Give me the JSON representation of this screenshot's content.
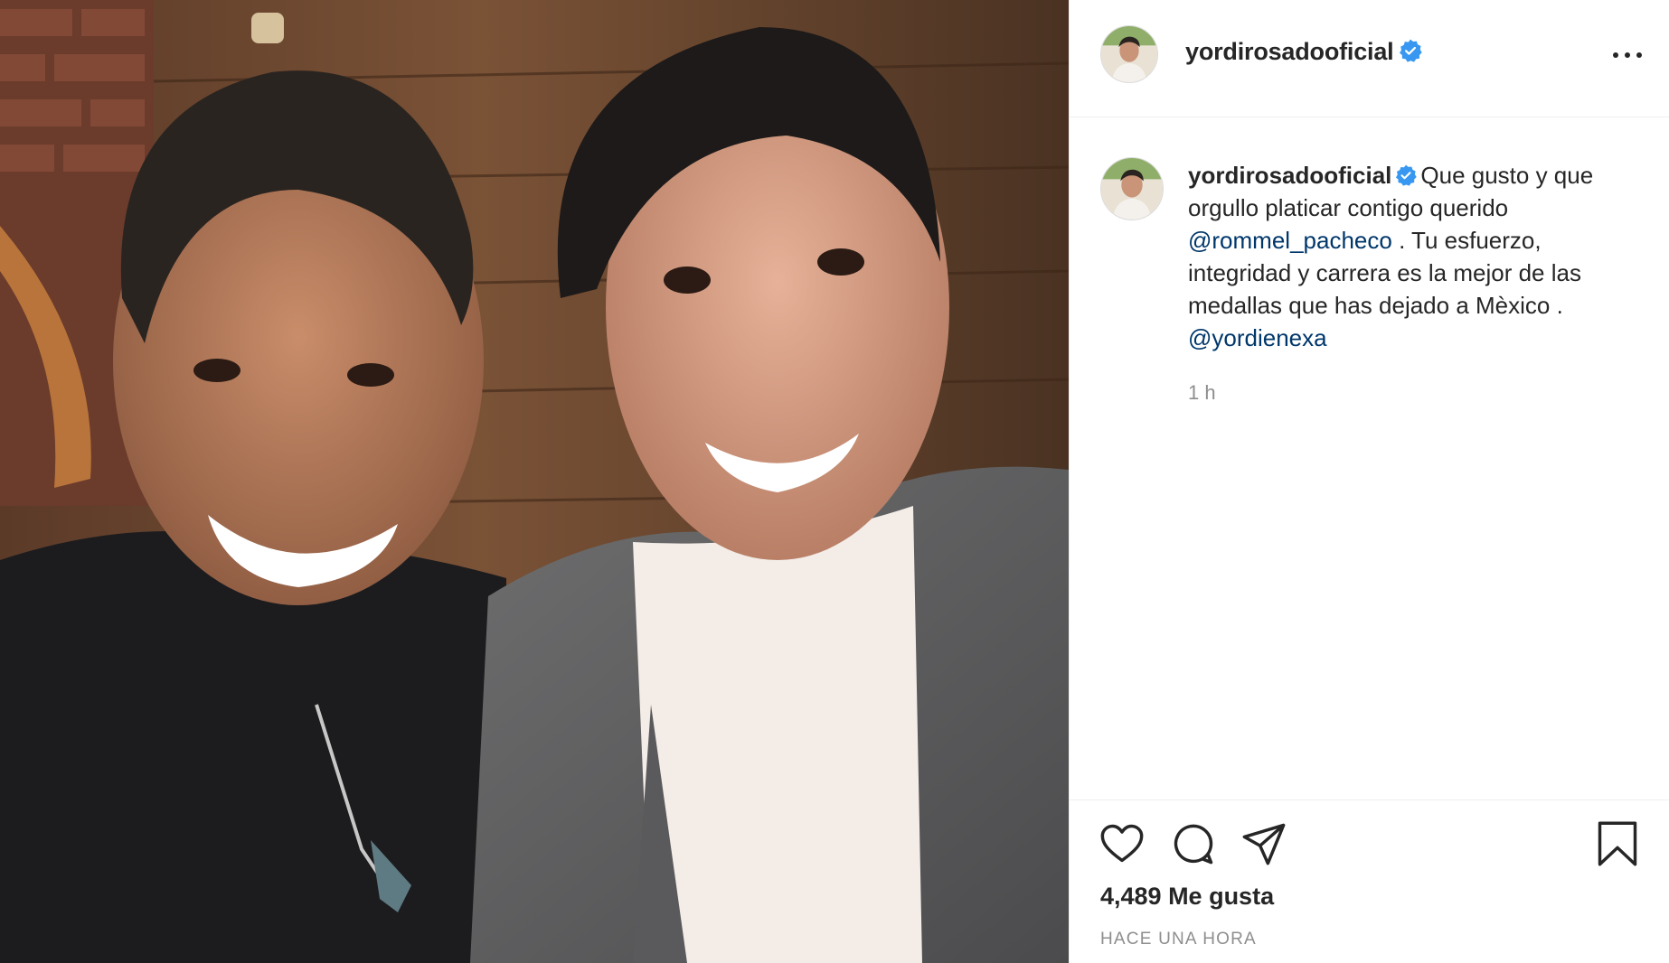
{
  "post": {
    "username": "yordirosadooficial",
    "verified": true,
    "caption": {
      "username": "yordirosadooficial",
      "text_1": "Que gusto y que orgullo platicar contigo querido",
      "mention_1": "@rommel_pacheco",
      "text_2": ". Tu esfuerzo, integridad y carrera es la mejor de las medallas que has dejado a Mèxico .",
      "mention_2": "@yordienexa",
      "time": "1 h"
    },
    "likes": "4,489 Me gusta",
    "timestamp": "HACE UNA HORA"
  },
  "icons": {
    "more": "more-options-icon",
    "verified": "verified-badge-icon",
    "like": "heart-icon",
    "comment": "comment-icon",
    "share": "send-icon",
    "save": "bookmark-icon"
  },
  "colors": {
    "verified": "#3897f0",
    "mention": "#00376b",
    "text": "#262626",
    "muted": "#8e8e8e",
    "border": "#efefef"
  }
}
